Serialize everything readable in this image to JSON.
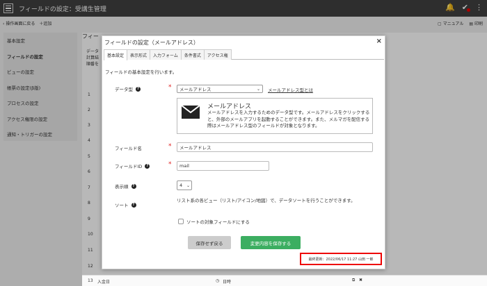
{
  "header": {
    "title": "フィールドの設定：受講生管理"
  },
  "toolbar": {
    "back": "操作画面に戻る",
    "add": "＋追加",
    "manual": "マニュアル",
    "print": "印刷"
  },
  "sidebar": {
    "items": [
      {
        "label": "基本設定"
      },
      {
        "label": "フィールドの設定"
      },
      {
        "label": "ビューの設定"
      },
      {
        "label": "帳票の設定(β版)"
      },
      {
        "label": "プロセスの設定"
      },
      {
        "label": "アクセス権限の設定"
      },
      {
        "label": "通知・トリガーの設定"
      }
    ]
  },
  "background": {
    "heading": "フィー",
    "labels": [
      "データ",
      "計算結",
      "順番を"
    ],
    "rows": [
      "1",
      "2",
      "3",
      "4",
      "5",
      "6",
      "7",
      "8",
      "9",
      "10",
      "11",
      "12"
    ],
    "last_row": {
      "num": "13",
      "name": "入金日",
      "type": "日時"
    }
  },
  "dialog": {
    "title": "フィールドの設定（メールアドレス）",
    "close": "×",
    "tabs": [
      {
        "label": "基本設定"
      },
      {
        "label": "表示形式"
      },
      {
        "label": "入力フォーム"
      },
      {
        "label": "条件書式"
      },
      {
        "label": "アクセス権"
      }
    ],
    "description": "フィールドの基本設定を行います。",
    "data_type": {
      "label": "データ型",
      "value": "メールアドレス",
      "link": "メールアドレス型とは"
    },
    "type_box": {
      "title": "メールアドレス",
      "text": "メールアドレスを入力するためのデータ型です。メールアドレスをクリックすると、外部のメールアプリを起動することができます。また、メルマガを配信する際はメールアドレス型のフィールドが対象となります。"
    },
    "field_name": {
      "label": "フィールド名",
      "value": "メールアドレス"
    },
    "field_id": {
      "label": "フィールドID",
      "value": "mail"
    },
    "display_order": {
      "label": "表示順",
      "value": "4"
    },
    "sort": {
      "label": "ソート",
      "text": "リスト系の各ビュー（リスト/アイコン/地図）で、データソートを行うことができます。",
      "checkbox_label": "ソートの対象フィールドにする"
    },
    "buttons": {
      "cancel": "保存せず戻る",
      "save": "変更内容を保存する"
    },
    "updated": "最終更新：2022/06/17 11:27 山田 一郎"
  }
}
